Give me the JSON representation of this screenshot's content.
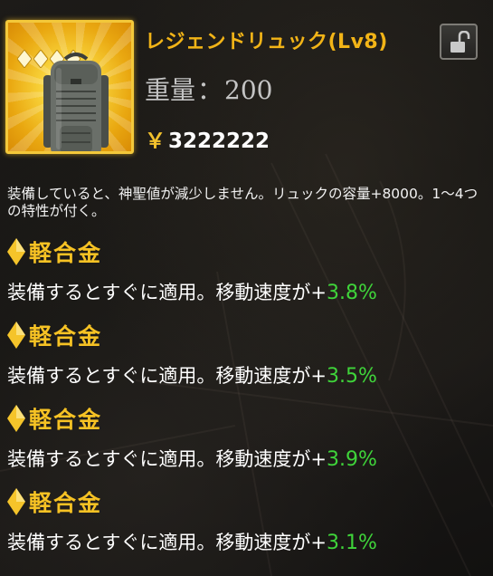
{
  "item": {
    "name": "レジェンドリュック(Lv8)",
    "weight_label": "重量",
    "weight_separator": "：",
    "weight_value": "200",
    "price_symbol": "￥",
    "price": "3222222",
    "rarity_stars": 4,
    "icon": "backpack-icon",
    "lock_icon": "lock-open-icon"
  },
  "description": "装備していると、神聖値が減少しません。リュックの容量+8000。1～4つの特性が付く。",
  "traits": [
    {
      "name": "軽合金",
      "effect": "装備するとすぐに適用。移動速度が",
      "sign": "+",
      "value": "3.8%"
    },
    {
      "name": "軽合金",
      "effect": "装備するとすぐに適用。移動速度が",
      "sign": "+",
      "value": "3.5%"
    },
    {
      "name": "軽合金",
      "effect": "装備するとすぐに適用。移動速度が",
      "sign": "+",
      "value": "3.9%"
    },
    {
      "name": "軽合金",
      "effect": "装備するとすぐに適用。移動速度が",
      "sign": "+",
      "value": "3.1%"
    }
  ],
  "colors": {
    "item_name": "#f2b417",
    "trait_name": "#f6c224",
    "stat_value": "#3fd43a",
    "frame_gold": "#f3c83a"
  }
}
